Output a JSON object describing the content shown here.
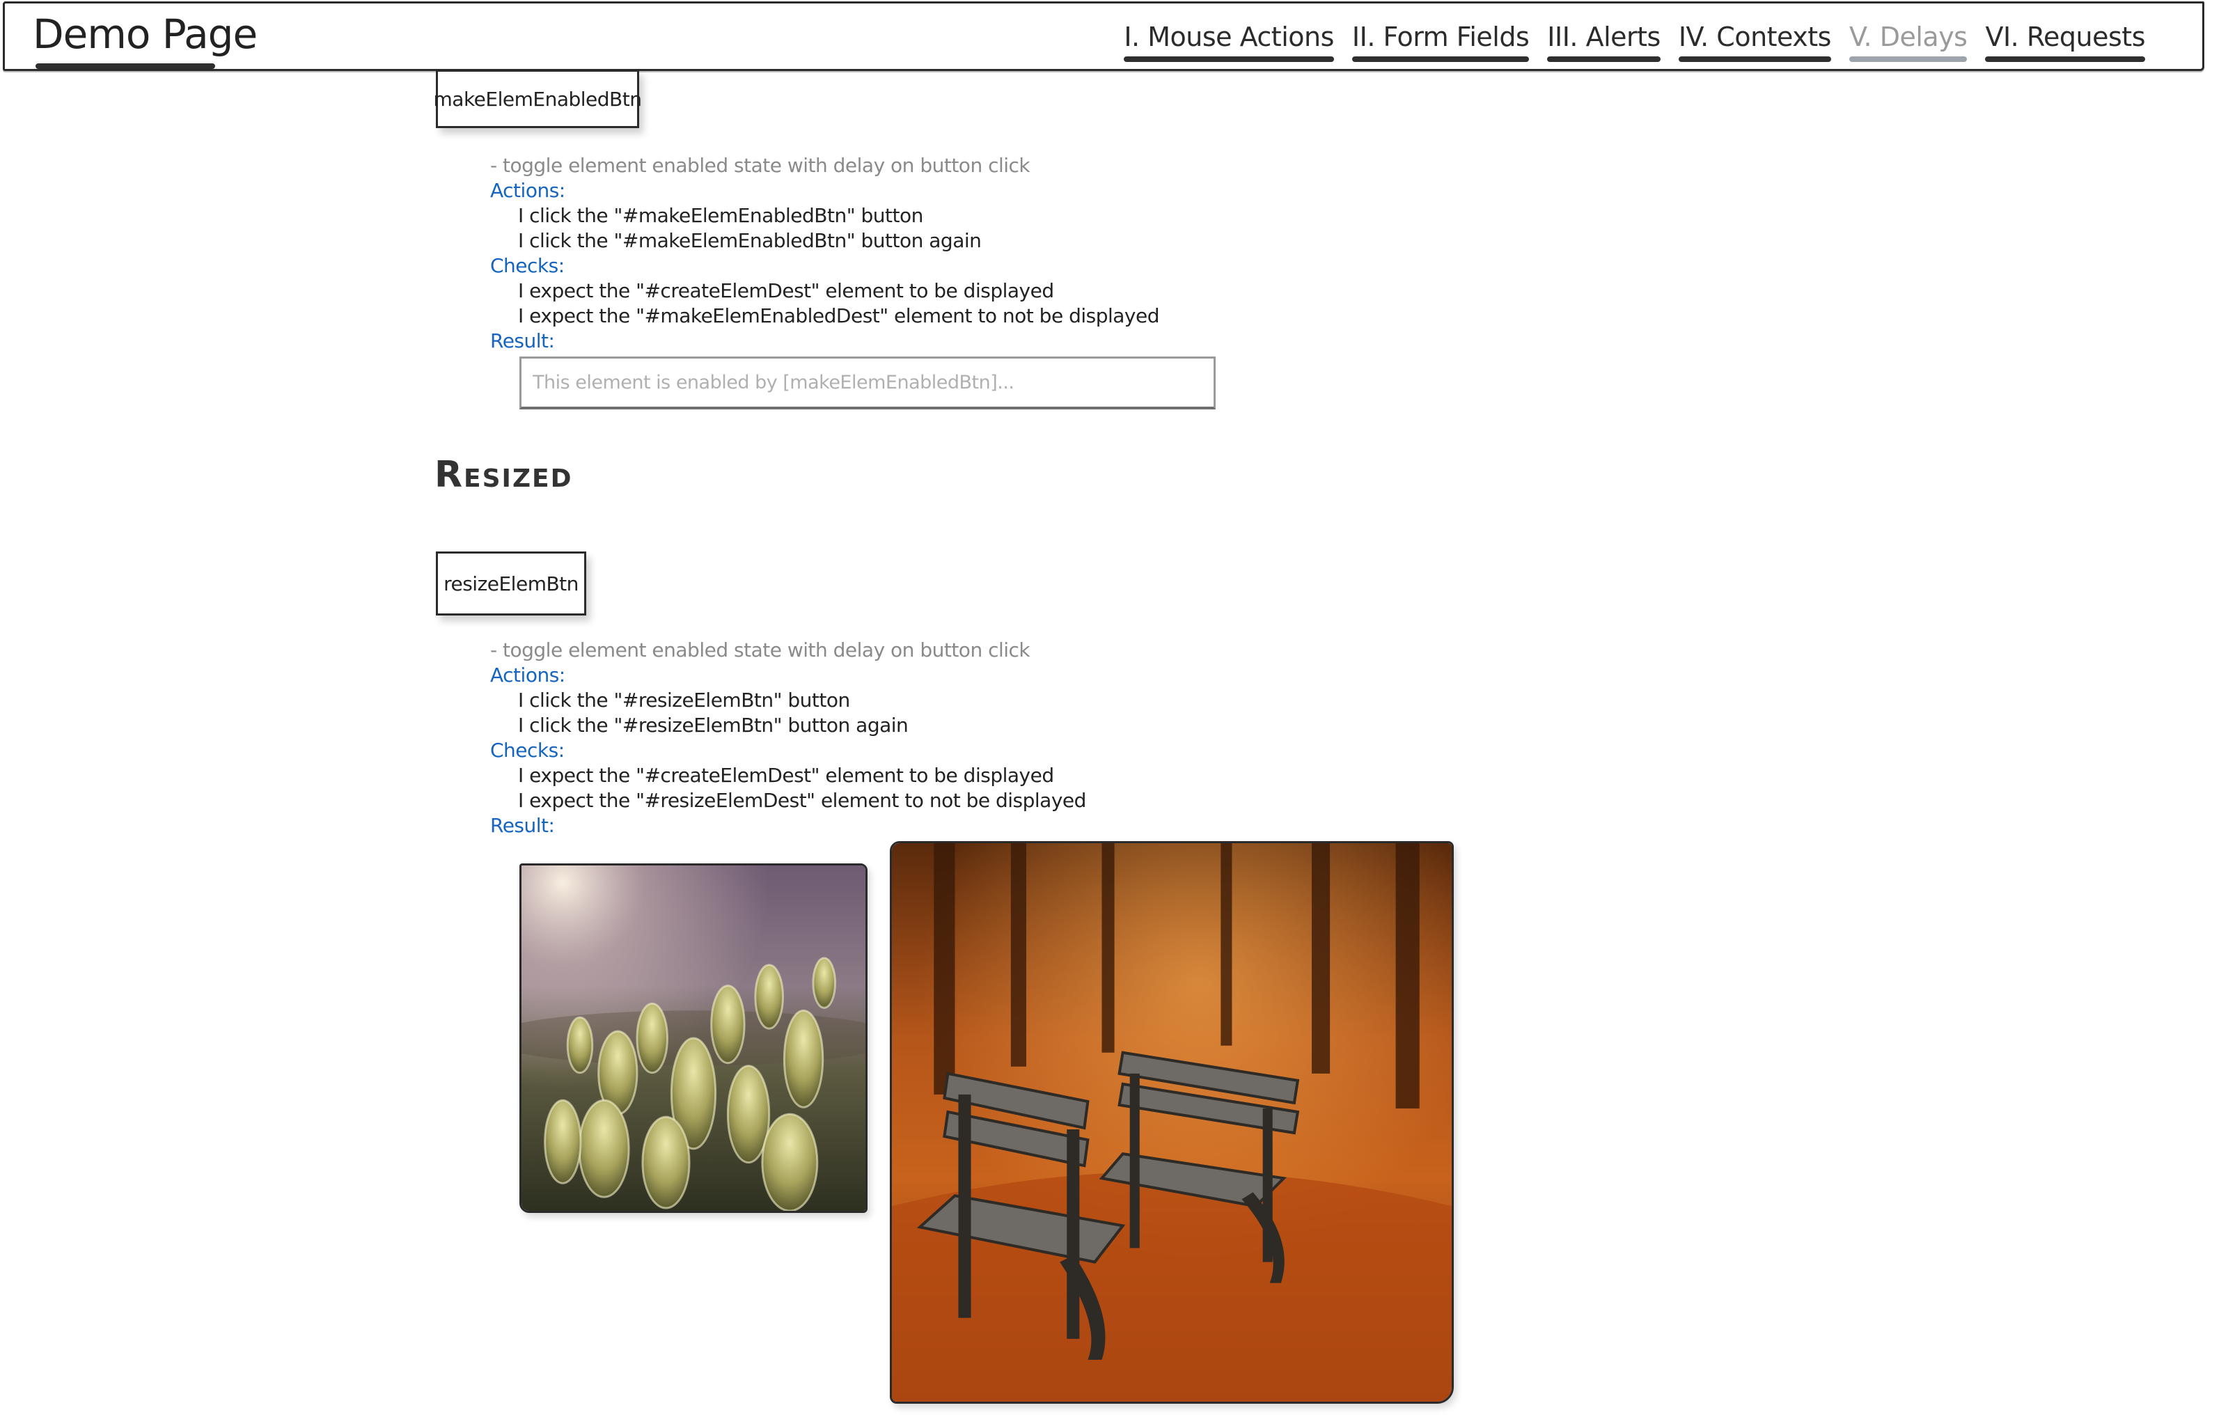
{
  "navbar": {
    "brand": "Demo Page",
    "items": [
      {
        "label": "I. Mouse Actions",
        "active": false
      },
      {
        "label": "II. Form Fields",
        "active": false
      },
      {
        "label": "III. Alerts",
        "active": false
      },
      {
        "label": "IV. Contexts",
        "active": false
      },
      {
        "label": "V. Delays",
        "active": true
      },
      {
        "label": "VI. Requests",
        "active": false
      }
    ]
  },
  "enabled_section": {
    "button_label": "makeElemEnabledBtn",
    "description": "- toggle element enabled state with delay on button click",
    "actions_heading": "Actions:",
    "actions": [
      "I click the \"#makeElemEnabledBtn\" button",
      "I click the \"#makeElemEnabledBtn\" button again"
    ],
    "checks_heading": "Checks:",
    "checks": [
      "I expect the \"#createElemDest\" element to be displayed",
      "I expect the \"#makeElemEnabledDest\" element to not be displayed"
    ],
    "result_heading": "Result:",
    "result_placeholder": "This element is enabled by [makeElemEnabledBtn]..."
  },
  "resized_section": {
    "title": "Resized",
    "button_label": "resizeElemBtn",
    "description": "- toggle element enabled state with delay on button click",
    "actions_heading": "Actions:",
    "actions": [
      "I click the \"#resizeElemBtn\" button",
      "I click the \"#resizeElemBtn\" button again"
    ],
    "checks_heading": "Checks:",
    "checks": [
      "I expect the \"#createElemDest\" element to be displayed",
      "I expect the \"#resizeElemDest\" element to not be displayed"
    ],
    "result_heading": "Result:"
  },
  "colors": {
    "heading_blue": "#1565c0",
    "muted_text": "#8a8a8a",
    "active_nav": "#9a9a9a"
  }
}
